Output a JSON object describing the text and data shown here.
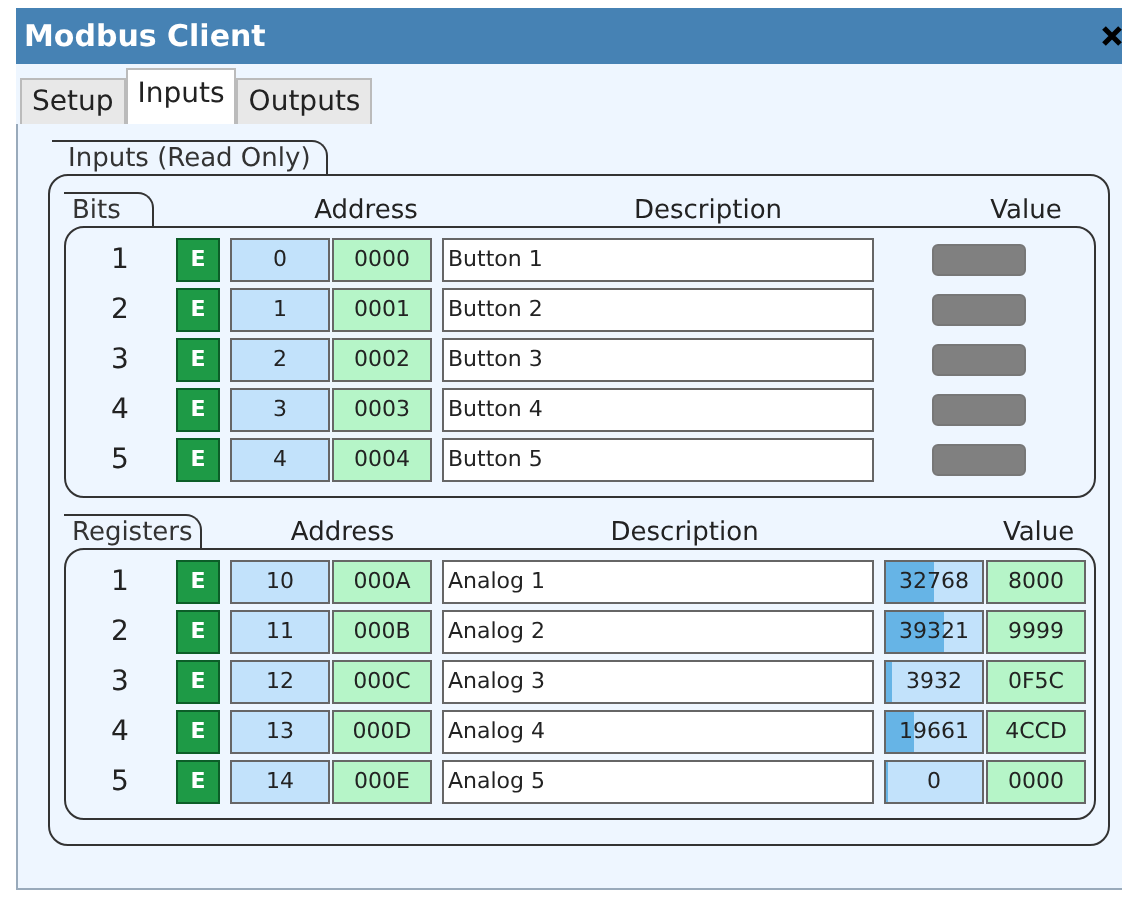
{
  "window": {
    "title": "Modbus Client"
  },
  "tabs": [
    {
      "label": "Setup",
      "selected": false
    },
    {
      "label": "Inputs",
      "selected": true
    },
    {
      "label": "Outputs",
      "selected": false
    }
  ],
  "group": {
    "title": "Inputs (Read Only)"
  },
  "bits": {
    "title": "Bits",
    "columns": [
      "Address",
      "Description",
      "Value"
    ],
    "rows": [
      {
        "index": "1",
        "enable": "E",
        "address": "0",
        "hex": "0000",
        "description": "Button 1",
        "on": false
      },
      {
        "index": "2",
        "enable": "E",
        "address": "1",
        "hex": "0001",
        "description": "Button 2",
        "on": false
      },
      {
        "index": "3",
        "enable": "E",
        "address": "2",
        "hex": "0002",
        "description": "Button 3",
        "on": false
      },
      {
        "index": "4",
        "enable": "E",
        "address": "3",
        "hex": "0003",
        "description": "Button 4",
        "on": false
      },
      {
        "index": "5",
        "enable": "E",
        "address": "4",
        "hex": "0004",
        "description": "Button 5",
        "on": false
      }
    ]
  },
  "registers": {
    "title": "Registers",
    "columns": [
      "Address",
      "Description",
      "Value"
    ],
    "rows": [
      {
        "index": "1",
        "enable": "E",
        "address": "10",
        "hex": "000A",
        "description": "Analog 1",
        "value": "32768",
        "level": 0.5,
        "value_hex": "8000"
      },
      {
        "index": "2",
        "enable": "E",
        "address": "11",
        "hex": "000B",
        "description": "Analog 2",
        "value": "39321",
        "level": 0.6,
        "value_hex": "9999"
      },
      {
        "index": "3",
        "enable": "E",
        "address": "12",
        "hex": "000C",
        "description": "Analog 3",
        "value": "3932",
        "level": 0.06,
        "value_hex": "0F5C"
      },
      {
        "index": "4",
        "enable": "E",
        "address": "13",
        "hex": "000D",
        "description": "Analog 4",
        "value": "19661",
        "level": 0.3,
        "value_hex": "4CCD"
      },
      {
        "index": "5",
        "enable": "E",
        "address": "14",
        "hex": "000E",
        "description": "Analog 5",
        "value": "0",
        "level": 0,
        "value_hex": "0000"
      }
    ]
  }
}
